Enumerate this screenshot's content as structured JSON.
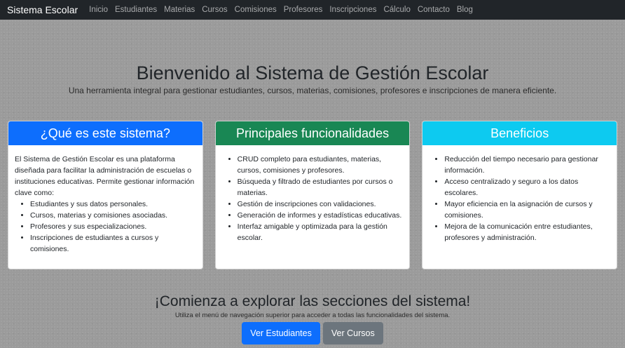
{
  "nav": {
    "brand": "Sistema Escolar",
    "items": [
      "Inicio",
      "Estudiantes",
      "Materias",
      "Cursos",
      "Comisiones",
      "Profesores",
      "Inscripciones",
      "Cálculo",
      "Contacto",
      "Blog"
    ]
  },
  "hero": {
    "title": "Bienvenido al Sistema de Gestión Escolar",
    "subtitle": "Una herramienta integral para gestionar estudiantes, cursos, materias, comisiones, profesores e inscripciones de manera eficiente."
  },
  "cards": [
    {
      "title": "¿Qué es este sistema?",
      "color": "#0d6efd",
      "intro": "El Sistema de Gestión Escolar es una plataforma diseñada para facilitar la administración de escuelas o instituciones educativas. Permite gestionar información clave como:",
      "items": [
        "Estudiantes y sus datos personales.",
        "Cursos, materias y comisiones asociadas.",
        "Profesores y sus especializaciones.",
        "Inscripciones de estudiantes a cursos y comisiones."
      ]
    },
    {
      "title": "Principales funcionalidades",
      "color": "#198754",
      "items": [
        "CRUD completo para estudiantes, materias, cursos, comisiones y profesores.",
        "Búsqueda y filtrado de estudiantes por cursos o materias.",
        "Gestión de inscripciones con validaciones.",
        "Generación de informes y estadísticas educativas.",
        "Interfaz amigable y optimizada para la gestión escolar."
      ]
    },
    {
      "title": "Beneficios",
      "color": "#0dcaf0",
      "items": [
        "Reducción del tiempo necesario para gestionar información.",
        "Acceso centralizado y seguro a los datos escolares.",
        "Mayor eficiencia en la asignación de cursos y comisiones.",
        "Mejora de la comunicación entre estudiantes, profesores y administración."
      ]
    }
  ],
  "cta": {
    "title": "¡Comienza a explorar las secciones del sistema!",
    "subtitle": "Utiliza el menú de navegación superior para acceder a todas las funcionalidades del sistema.",
    "primary_button": "Ver Estudiantes",
    "primary_color": "#0d6efd",
    "secondary_button": "Ver Cursos",
    "secondary_color": "#6c757d"
  }
}
